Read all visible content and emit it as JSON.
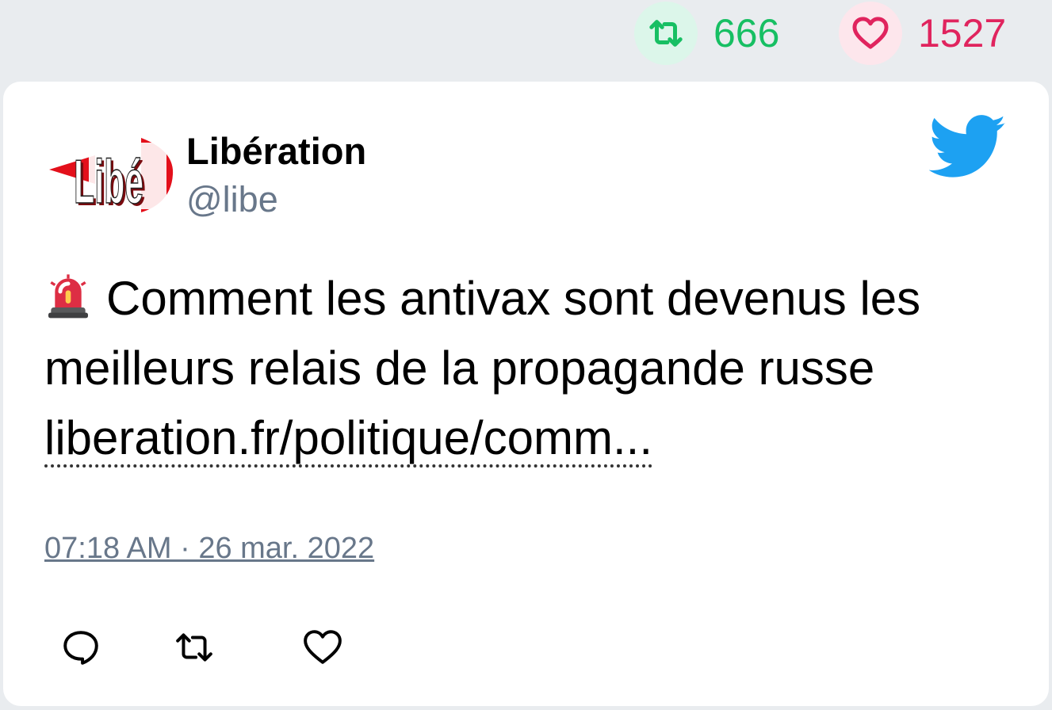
{
  "stats": {
    "retweet_icon": "retweet-icon",
    "retweet_count": "666",
    "retweet_color": "#17bf63",
    "like_icon": "heart-icon",
    "like_count": "1527",
    "like_color": "#e0245e"
  },
  "tweet": {
    "author_name": "Libération",
    "author_handle": "@libe",
    "avatar_icon": "libe-logo",
    "platform_icon": "twitter-bird-icon",
    "emoji_icon": "rotating-light-icon",
    "text": "Comment les antivax sont devenus les meilleurs relais de la propagande russe",
    "link_text": "liberation.fr/politique/comm...",
    "timestamp": "07:18 AM · 26 mar. 2022",
    "accent_color": "#1da1f2",
    "handle_color": "#68778a"
  },
  "actions": [
    {
      "icon": "reply-icon"
    },
    {
      "icon": "retweet-icon"
    },
    {
      "icon": "heart-icon"
    }
  ],
  "avatar_logo_text": "Libé"
}
